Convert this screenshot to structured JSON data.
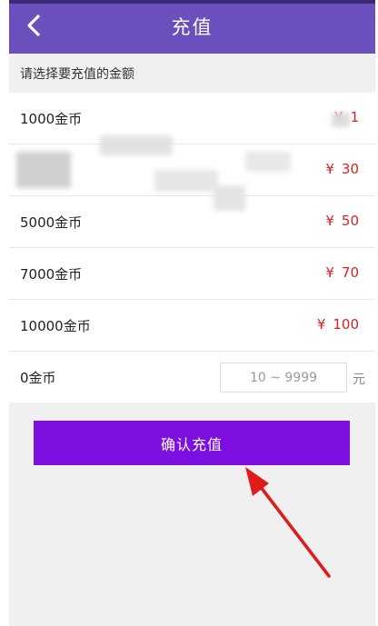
{
  "header": {
    "back_icon": "chevron-left-icon",
    "title": "充值"
  },
  "prompt": "请选择要充值的金额",
  "options": [
    {
      "coins": "1000金币",
      "currency": "¥",
      "price": "1"
    },
    {
      "coins": "",
      "currency": "¥",
      "price": "30"
    },
    {
      "coins": "5000金币",
      "currency": "¥",
      "price": "50"
    },
    {
      "coins": "7000金币",
      "currency": "¥",
      "price": "70"
    },
    {
      "coins": "10000金币",
      "currency": "¥",
      "price": "100"
    }
  ],
  "custom": {
    "coins": "0金币",
    "placeholder": "10 ~ 9999",
    "unit": "元"
  },
  "confirm_label": "确认充值",
  "colors": {
    "header_bg": "#6a4fbd",
    "button_bg": "#7d0fe0",
    "price_red": "#d42222",
    "annotation_arrow": "#e01b1b"
  }
}
